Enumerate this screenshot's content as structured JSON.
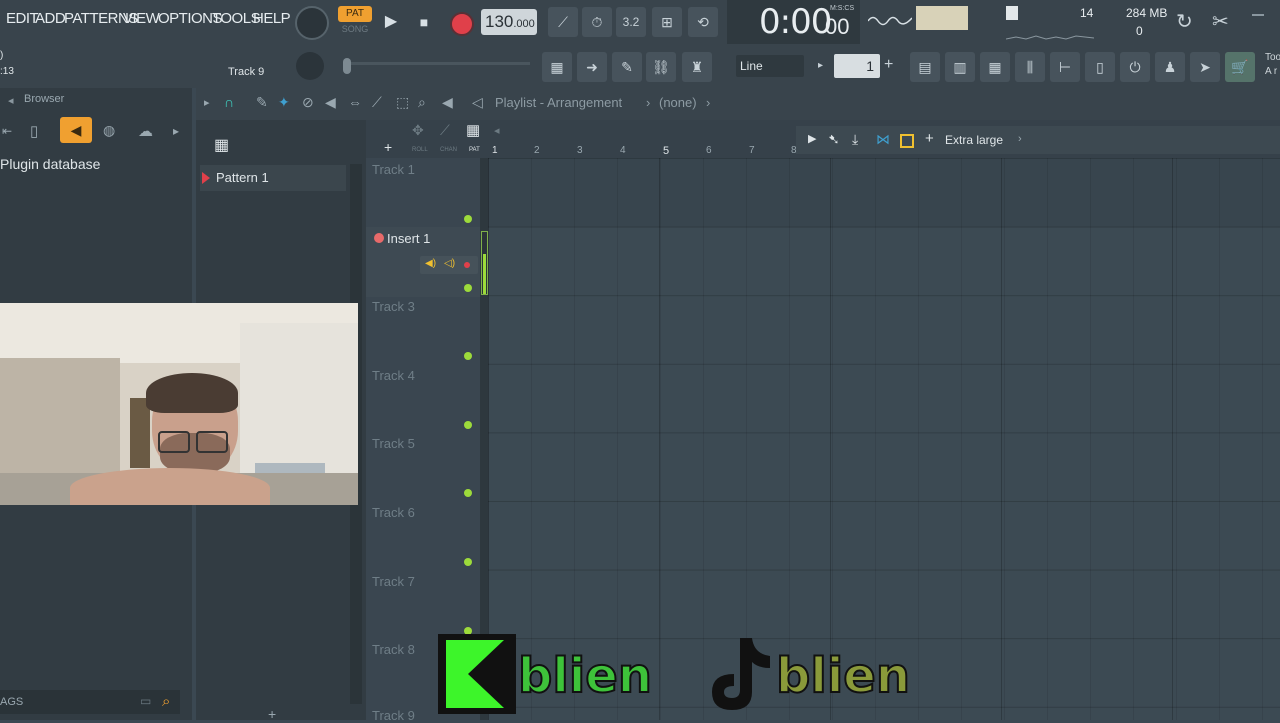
{
  "menu": [
    "EDIT",
    "ADD",
    "PATTERNS",
    "VIEW",
    "OPTIONS",
    "TOOLS",
    "HELP"
  ],
  "transport": {
    "pat_label": "PAT",
    "song_label": "SONG",
    "tempo": "130",
    "tempo_frac": ".000",
    "time": "0:00",
    "time_frac": "00",
    "time_unit": "M:S:CS",
    "snap": "Line",
    "pattern_num": "1"
  },
  "status": {
    "cpu": "14",
    "mem": "284 MB",
    "poly": "0",
    "hint_line1": ")",
    "hint_line2": ":13",
    "track_label": "Track 9",
    "right_clip1": "Too",
    "right_clip2": "A r"
  },
  "browser": {
    "title": "Browser",
    "plugin_db": "Plugin database",
    "tags_label": "AGS"
  },
  "channel": {
    "pattern": "Pattern 1"
  },
  "playlist": {
    "title": "Playlist - Arrangement",
    "sep": "›",
    "current": "(none)",
    "zoom": "Extra large",
    "col_labels": [
      "ROLL",
      "CHAN",
      "PAT"
    ],
    "ruler": [
      "1",
      "2",
      "3",
      "4",
      "5",
      "6",
      "7",
      "8"
    ],
    "tracks": [
      {
        "name": "Track 1"
      },
      {
        "name": "Insert 1"
      },
      {
        "name": "Track 3"
      },
      {
        "name": "Track 4"
      },
      {
        "name": "Track 5"
      },
      {
        "name": "Track 6"
      },
      {
        "name": "Track 7"
      },
      {
        "name": "Track 8"
      },
      {
        "name": "Track 9"
      }
    ]
  },
  "watermark": {
    "brand1": "blien",
    "brand2": "blien"
  },
  "colors": {
    "accent_orange": "#f0a030",
    "record_red": "#e0404a",
    "green": "#9ddb3b",
    "watermark_green": "#3df52a"
  }
}
